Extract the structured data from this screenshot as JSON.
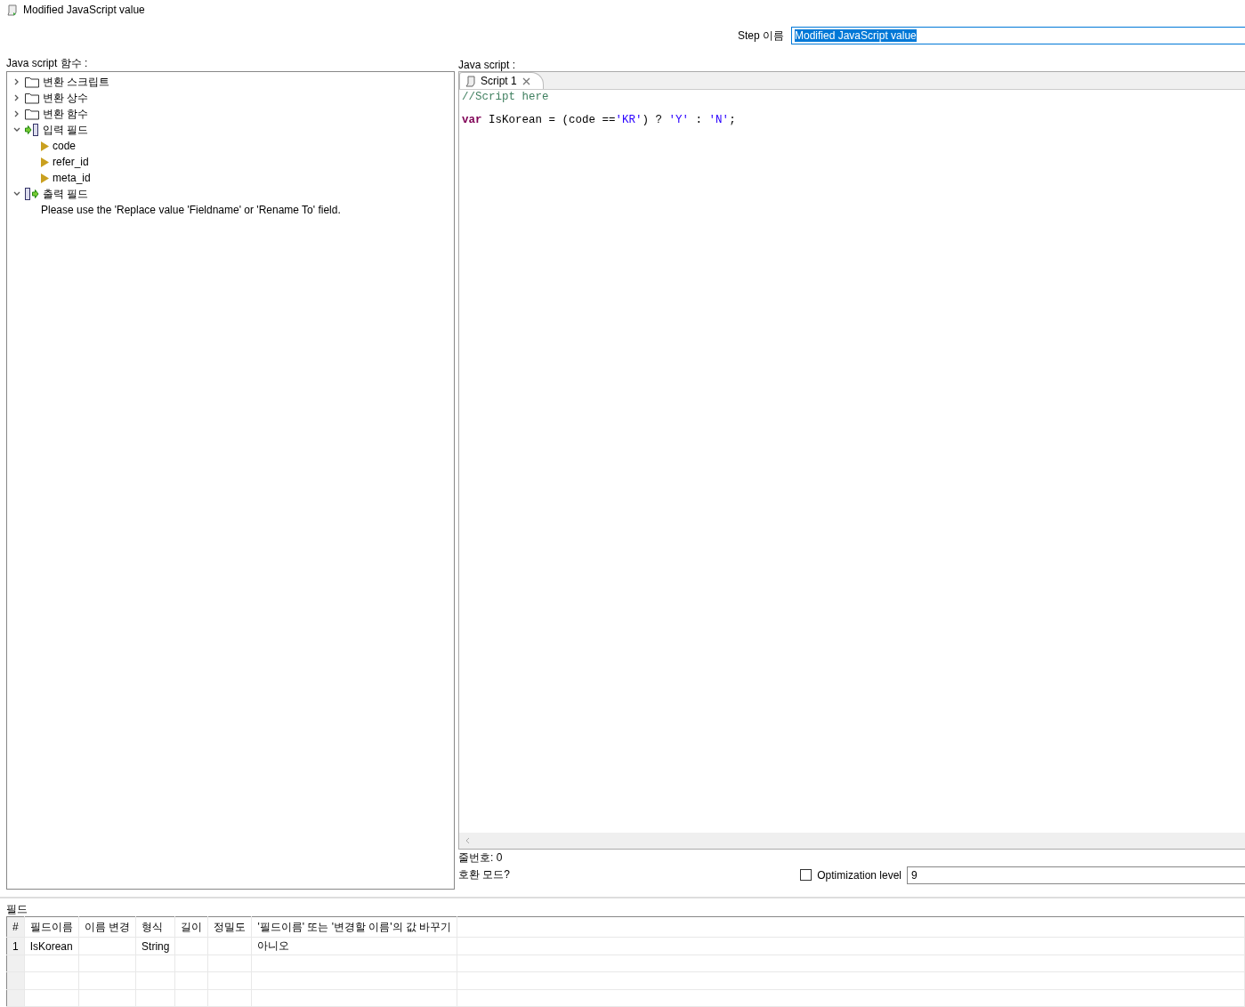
{
  "window": {
    "title": "Modified JavaScript value"
  },
  "step_name": {
    "label": "Step 이름",
    "value": "Modified JavaScript value"
  },
  "functions_panel": {
    "label": "Java script 함수 :",
    "tree": [
      {
        "kind": "folder",
        "label": "변환 스크립트",
        "expanded": false
      },
      {
        "kind": "folder",
        "label": "변환 상수",
        "expanded": false
      },
      {
        "kind": "folder",
        "label": "변환 함수",
        "expanded": false
      },
      {
        "kind": "input",
        "label": "입력 필드",
        "expanded": true,
        "children": [
          {
            "kind": "field",
            "label": "code"
          },
          {
            "kind": "field",
            "label": "refer_id"
          },
          {
            "kind": "field",
            "label": "meta_id"
          }
        ]
      },
      {
        "kind": "output",
        "label": "출력 필드",
        "expanded": true,
        "children": [
          {
            "kind": "note",
            "label": "Please use the 'Replace value 'Fieldname' or 'Rename To' field."
          }
        ]
      }
    ]
  },
  "script_panel": {
    "label": "Java script :",
    "tabs": [
      {
        "label": "Script 1",
        "selected": true
      }
    ],
    "code_lines": [
      [
        {
          "kind": "comment",
          "text": "//Script here"
        }
      ],
      [
        {
          "kind": "keyword",
          "text": "var"
        },
        {
          "kind": "plain",
          "text": " IsKorean = (code =="
        },
        {
          "kind": "string",
          "text": "'KR'"
        },
        {
          "kind": "plain",
          "text": ") ? "
        },
        {
          "kind": "string",
          "text": "'Y'"
        },
        {
          "kind": "plain",
          "text": " : "
        },
        {
          "kind": "string",
          "text": "'N'"
        },
        {
          "kind": "plain",
          "text": ";"
        }
      ]
    ]
  },
  "line_number": "줄번호: 0",
  "compat_mode": "호환 모드?",
  "optimization": {
    "label": "Optimization level",
    "checked": false,
    "value": "9"
  },
  "fields": {
    "label": "필드",
    "columns": [
      "#",
      "필드이름",
      "이름 변경",
      "형식",
      "길이",
      "정밀도",
      "'필드이름' 또는 '변경할 이름'의 값 바꾸기"
    ],
    "rows": [
      [
        "1",
        "IsKorean",
        "",
        "String",
        "",
        "",
        "아니오"
      ]
    ]
  }
}
